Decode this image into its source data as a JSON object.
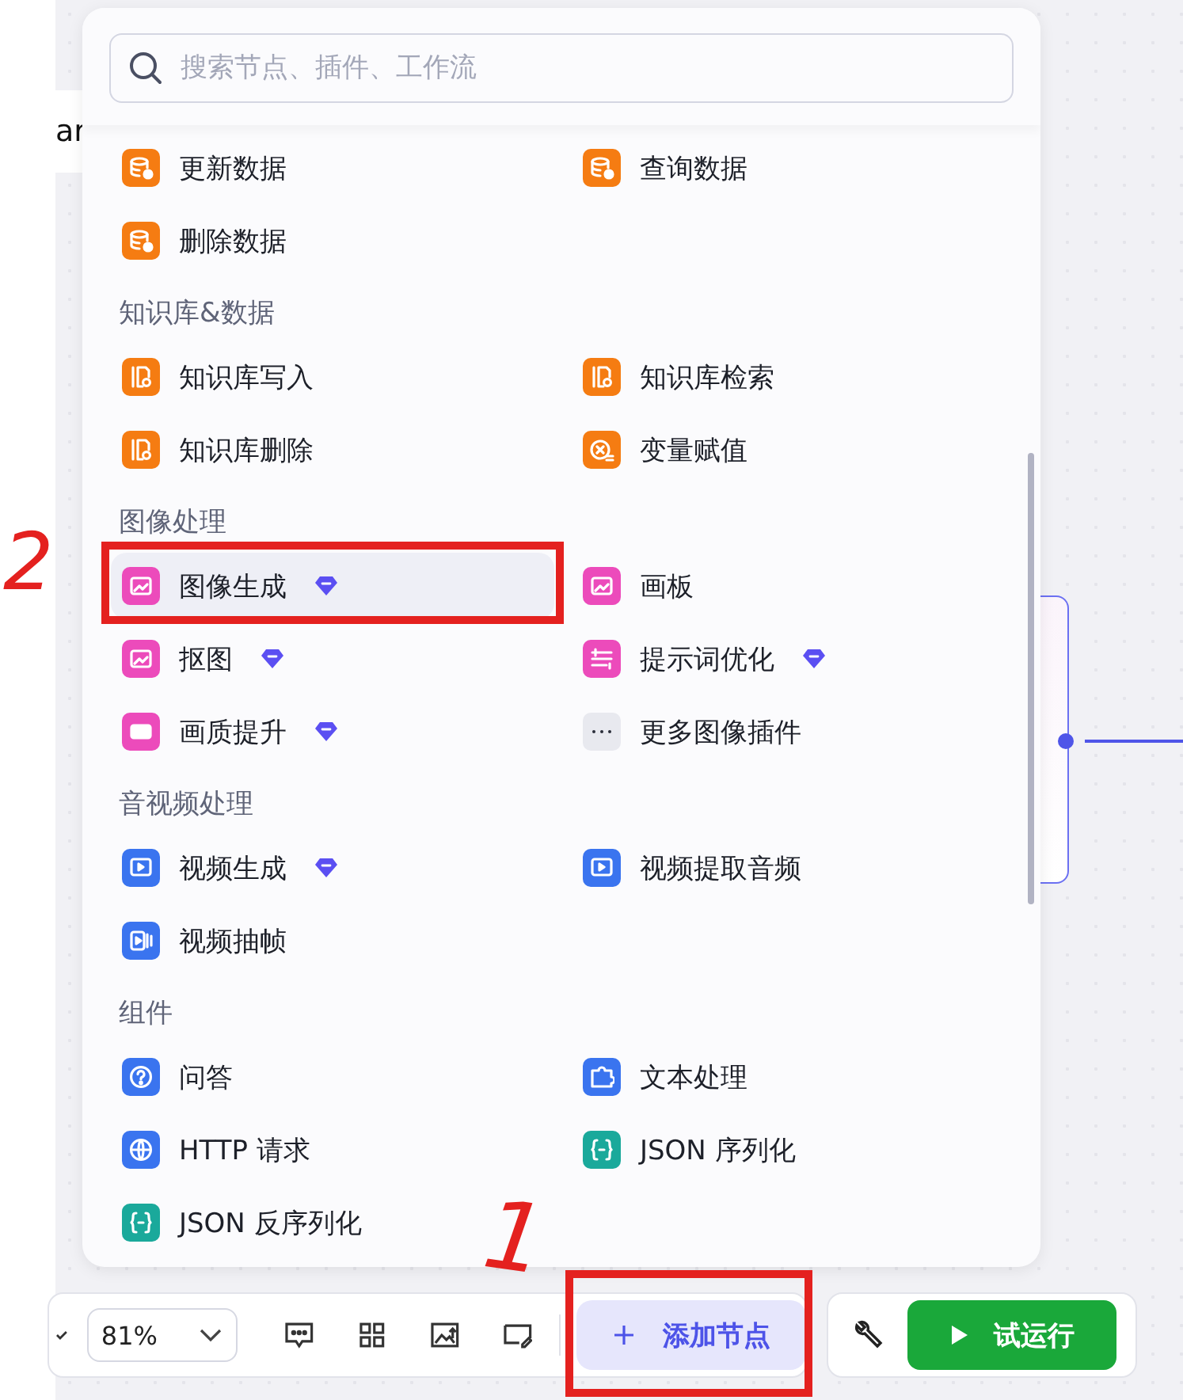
{
  "background_text": "ar",
  "search": {
    "placeholder": "搜索节点、插件、工作流"
  },
  "sections": [
    {
      "items": [
        {
          "label": "更新数据",
          "color": "#f57c12",
          "premium": false,
          "selected": false
        },
        {
          "label": "查询数据",
          "color": "#f57c12",
          "premium": false,
          "selected": false
        },
        {
          "label": "删除数据",
          "color": "#f57c12",
          "premium": false,
          "selected": false
        }
      ]
    },
    {
      "title": "知识库&数据",
      "items": [
        {
          "label": "知识库写入",
          "color": "#f57c12",
          "premium": false,
          "selected": false
        },
        {
          "label": "知识库检索",
          "color": "#f57c12",
          "premium": false,
          "selected": false
        },
        {
          "label": "知识库删除",
          "color": "#f57c12",
          "premium": false,
          "selected": false
        },
        {
          "label": "变量赋值",
          "color": "#f57c12",
          "premium": false,
          "selected": false
        }
      ]
    },
    {
      "title": "图像处理",
      "items": [
        {
          "label": "图像生成",
          "color": "#ec4bbb",
          "premium": true,
          "selected": true
        },
        {
          "label": "画板",
          "color": "#ec4bbb",
          "premium": false,
          "selected": false
        },
        {
          "label": "抠图",
          "color": "#ec4bbb",
          "premium": true,
          "selected": false
        },
        {
          "label": "提示词优化",
          "color": "#ec4bbb",
          "premium": true,
          "selected": false
        },
        {
          "label": "画质提升",
          "color": "#ec4bbb",
          "premium": true,
          "selected": false
        },
        {
          "label": "更多图像插件",
          "color": "#e8e9ef",
          "premium": false,
          "selected": false
        }
      ]
    },
    {
      "title": "音视频处理",
      "items": [
        {
          "label": "视频生成",
          "color": "#3a74ef",
          "premium": true,
          "selected": false
        },
        {
          "label": "视频提取音频",
          "color": "#3a74ef",
          "premium": false,
          "selected": false
        },
        {
          "label": "视频抽帧",
          "color": "#3a74ef",
          "premium": false,
          "selected": false
        }
      ]
    },
    {
      "title": "组件",
      "items": [
        {
          "label": "问答",
          "color": "#3a74ef",
          "premium": false,
          "selected": false
        },
        {
          "label": "文本处理",
          "color": "#3a74ef",
          "premium": false,
          "selected": false
        },
        {
          "label": "HTTP 请求",
          "color": "#3a74ef",
          "premium": false,
          "selected": false
        },
        {
          "label": "JSON 序列化",
          "color": "#1aa99b",
          "premium": false,
          "selected": false
        },
        {
          "label": "JSON 反序列化",
          "color": "#1aa99b",
          "premium": false,
          "selected": false
        }
      ]
    }
  ],
  "toolbar": {
    "zoom": "81%",
    "add_node": "添加节点",
    "run": "试运行"
  },
  "annotations": [
    {
      "kind": "box"
    },
    {
      "kind": "box"
    },
    {
      "kind": "mark",
      "label": "2"
    },
    {
      "kind": "mark",
      "label": "1"
    }
  ]
}
